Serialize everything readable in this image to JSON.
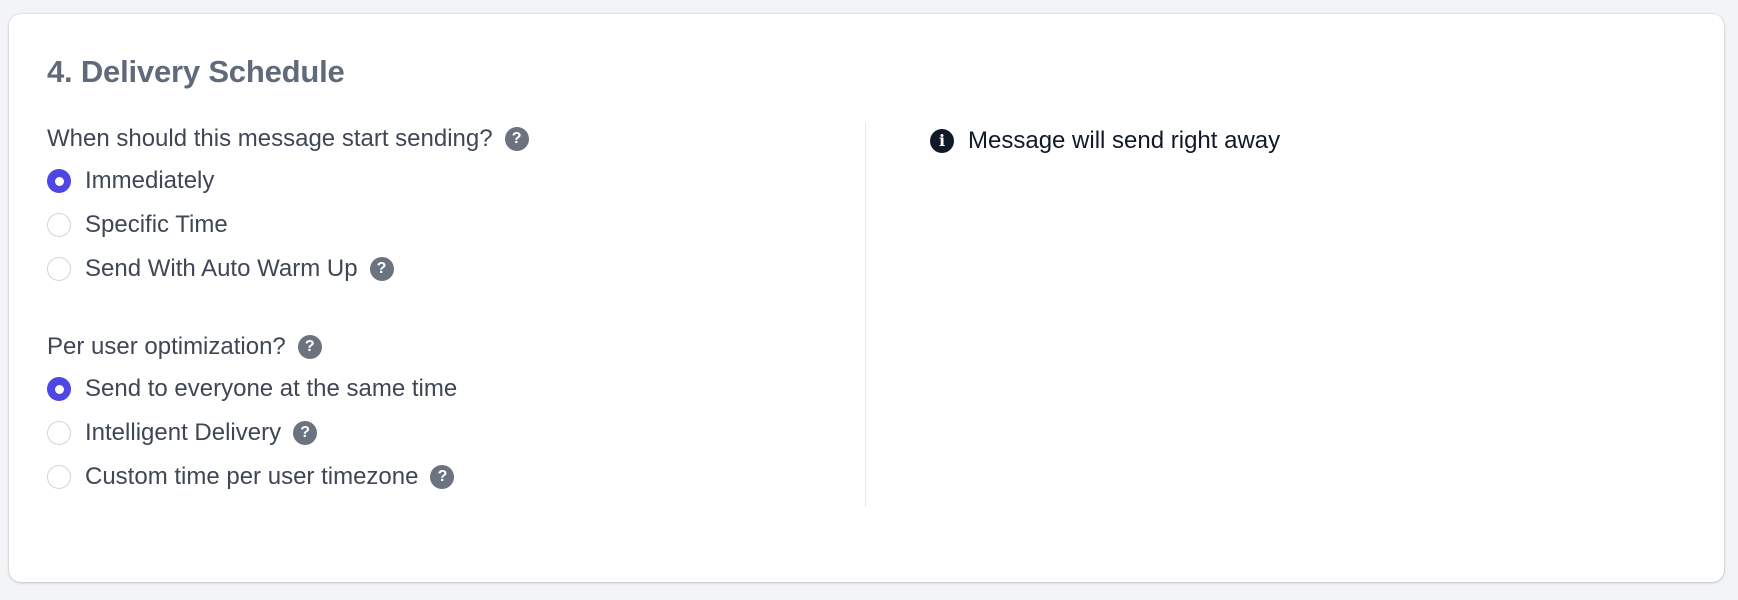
{
  "section": {
    "title": "4. Delivery Schedule"
  },
  "start_sending": {
    "question": "When should this message start sending?",
    "help_icon": "question-mark-icon",
    "options": [
      {
        "label": "Immediately",
        "selected": true,
        "has_help": false
      },
      {
        "label": "Specific Time",
        "selected": false,
        "has_help": false
      },
      {
        "label": "Send With Auto Warm Up",
        "selected": false,
        "has_help": true
      }
    ]
  },
  "optimization": {
    "question": "Per user optimization?",
    "help_icon": "question-mark-icon",
    "options": [
      {
        "label": "Send to everyone at the same time",
        "selected": true,
        "has_help": false
      },
      {
        "label": "Intelligent Delivery",
        "selected": false,
        "has_help": true
      },
      {
        "label": "Custom time per user timezone",
        "selected": false,
        "has_help": true
      }
    ]
  },
  "notice": {
    "icon": "info-icon",
    "text": "Message will send right away"
  },
  "colors": {
    "accent": "#4f46e5",
    "help_icon_bg": "#6b7280",
    "title": "#5f6b7a",
    "text": "#3f4754"
  }
}
